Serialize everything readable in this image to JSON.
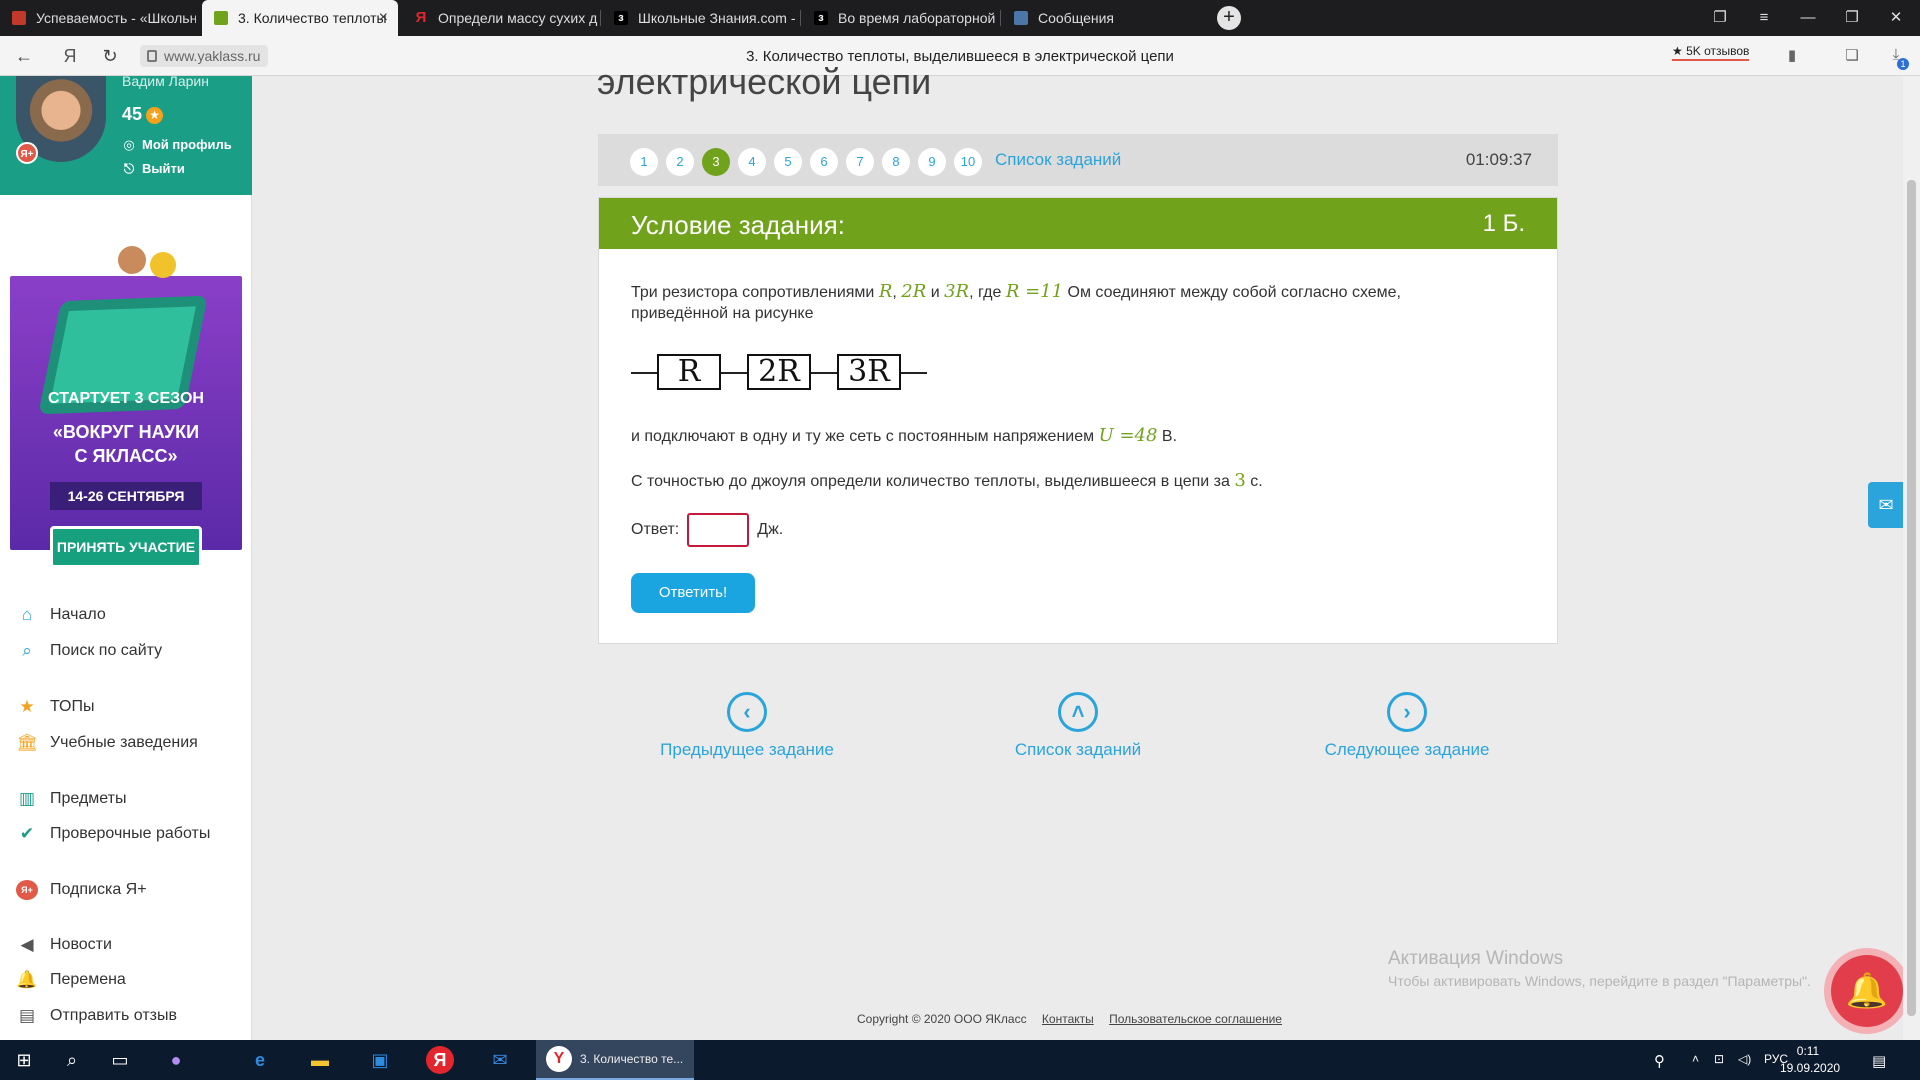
{
  "browser": {
    "tabs": [
      {
        "label": "Успеваемость - «Школьн",
        "icon": "yaklass-red-icon",
        "active": false
      },
      {
        "label": "3. Количество теплоты",
        "icon": "yaklass-book-icon",
        "active": true
      },
      {
        "label": "Определи массу сухих др",
        "icon": "yandex-icon",
        "active": false
      },
      {
        "label": "Школьные Знания.com - F",
        "icon": "znanija-icon",
        "active": false
      },
      {
        "label": "Во время лабораторной р",
        "icon": "znanija-icon",
        "active": false
      },
      {
        "label": "Сообщения",
        "icon": "messages-icon",
        "active": false
      }
    ],
    "url": "www.yaklass.ru",
    "page_title": "3. Количество теплоты, выделившееся в электрической цепи",
    "reviews": "★ 5K отзывов",
    "downloads_count": "1"
  },
  "sidebar": {
    "user_name": "Вадим Ларин",
    "points": "45",
    "profile_link": "Мой профиль",
    "logout_link": "Выйти",
    "promo": {
      "line1": "СТАРТУЕТ  3 СЕЗОН",
      "line2": "«ВОКРУГ НАУКИ",
      "line3": "С ЯКЛАСС»",
      "dates": "14-26 СЕНТЯБРЯ",
      "button": "ПРИНЯТЬ УЧАСТИЕ"
    },
    "menu": [
      {
        "label": "Начало",
        "icon": "home-icon"
      },
      {
        "label": "Поиск по сайту",
        "icon": "search-icon"
      },
      {
        "label": "ТОПы",
        "icon": "star-icon"
      },
      {
        "label": "Учебные заведения",
        "icon": "school-icon"
      },
      {
        "label": "Предметы",
        "icon": "books-icon"
      },
      {
        "label": "Проверочные работы",
        "icon": "check-circle-icon"
      },
      {
        "label": "Подписка Я+",
        "icon": "yaplus-icon"
      },
      {
        "label": "Новости",
        "icon": "megaphone-icon"
      },
      {
        "label": "Перемена",
        "icon": "bell-icon"
      },
      {
        "label": "Отправить отзыв",
        "icon": "feedback-icon"
      }
    ]
  },
  "main": {
    "heading": "электрической цепи",
    "task_numbers": [
      "1",
      "2",
      "3",
      "4",
      "5",
      "6",
      "7",
      "8",
      "9",
      "10"
    ],
    "current_task": "3",
    "task_list_link": "Список заданий",
    "timer": "01:09:37",
    "task": {
      "header": "Условие задания:",
      "points": "1 Б.",
      "p1_a": "Три резистора сопротивлениями ",
      "p1_R": "R",
      "p1_comma": ", ",
      "p1_2R": "2R",
      "p1_and": " и ",
      "p1_3R": "3R",
      "p1_where": ", где ",
      "p1_Req": "R =11",
      "p1_b": " Ом соединяют между собой согласно схеме,",
      "p1_c": "приведённой на рисунке",
      "circuit": [
        "R",
        "2R",
        "3R"
      ],
      "p2_a": "и подключают в одну и ту же сеть с постоянным напряжением ",
      "p2_U": "U =48",
      "p2_b": " В.",
      "p3_a": "С точностью до джоуля определи количество теплоты, выделившееся в цепи за ",
      "p3_t": "3",
      "p3_b": " с.",
      "answer_label": "Ответ:",
      "answer_value": "",
      "answer_unit": "Дж.",
      "submit": "Ответить!"
    },
    "nav": {
      "prev": "Предыдущее задание",
      "list": "Список заданий",
      "next": "Следующее задание"
    },
    "footer": {
      "copyright": "Copyright © 2020 ООО ЯКласс",
      "contacts": "Контакты",
      "agreement": "Пользовательское соглашение"
    }
  },
  "windows_watermark": {
    "title": "Активация Windows",
    "text": "Чтобы активировать Windows, перейдите в раздел \"Параметры\"."
  },
  "taskbar": {
    "active_window": "3. Количество те...",
    "language": "РУС",
    "time": "0:11",
    "date": "19.09.2020"
  }
}
